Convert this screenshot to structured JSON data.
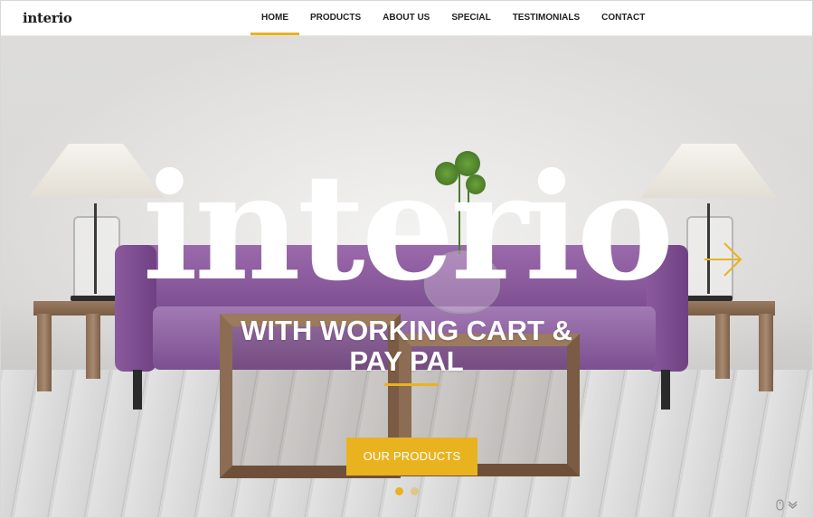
{
  "header": {
    "logo": "interio",
    "nav": [
      {
        "label": "HOME",
        "active": true
      },
      {
        "label": "PRODUCTS",
        "active": false
      },
      {
        "label": "ABOUT US",
        "active": false
      },
      {
        "label": "SPECIAL",
        "active": false
      },
      {
        "label": "TESTIMONIALS",
        "active": false
      },
      {
        "label": "CONTACT",
        "active": false
      }
    ]
  },
  "hero": {
    "title": "interio",
    "subtitle_line1": "WITH WORKING CART &",
    "subtitle_line2": "PAY PAL",
    "cta_label": "OUR PRODUCTS",
    "slides": {
      "count": 2,
      "active": 1
    },
    "next_icon": "chevron-right-icon",
    "scroll_icons": [
      "mouse-icon",
      "chevron-down-icon"
    ]
  },
  "colors": {
    "accent": "#e9b320",
    "text_dark": "#222222",
    "sofa": "#8a5a9d"
  }
}
